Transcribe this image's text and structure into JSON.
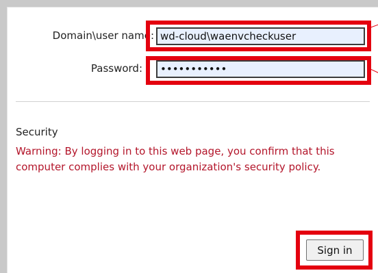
{
  "login": {
    "username_label": "Domain\\user name:",
    "username_value": "wd-cloud\\waenvcheckuser",
    "password_label": "Password:",
    "password_value": "•••••••••••"
  },
  "security": {
    "title": "Security",
    "warning": "Warning: By logging in to this web page, you confirm that this computer complies with your organization's security policy."
  },
  "actions": {
    "sign_in_label": "Sign in"
  },
  "colors": {
    "warning_text": "#b3152a",
    "highlight_box": "#e4000f",
    "input_background": "#e8f0fe"
  }
}
